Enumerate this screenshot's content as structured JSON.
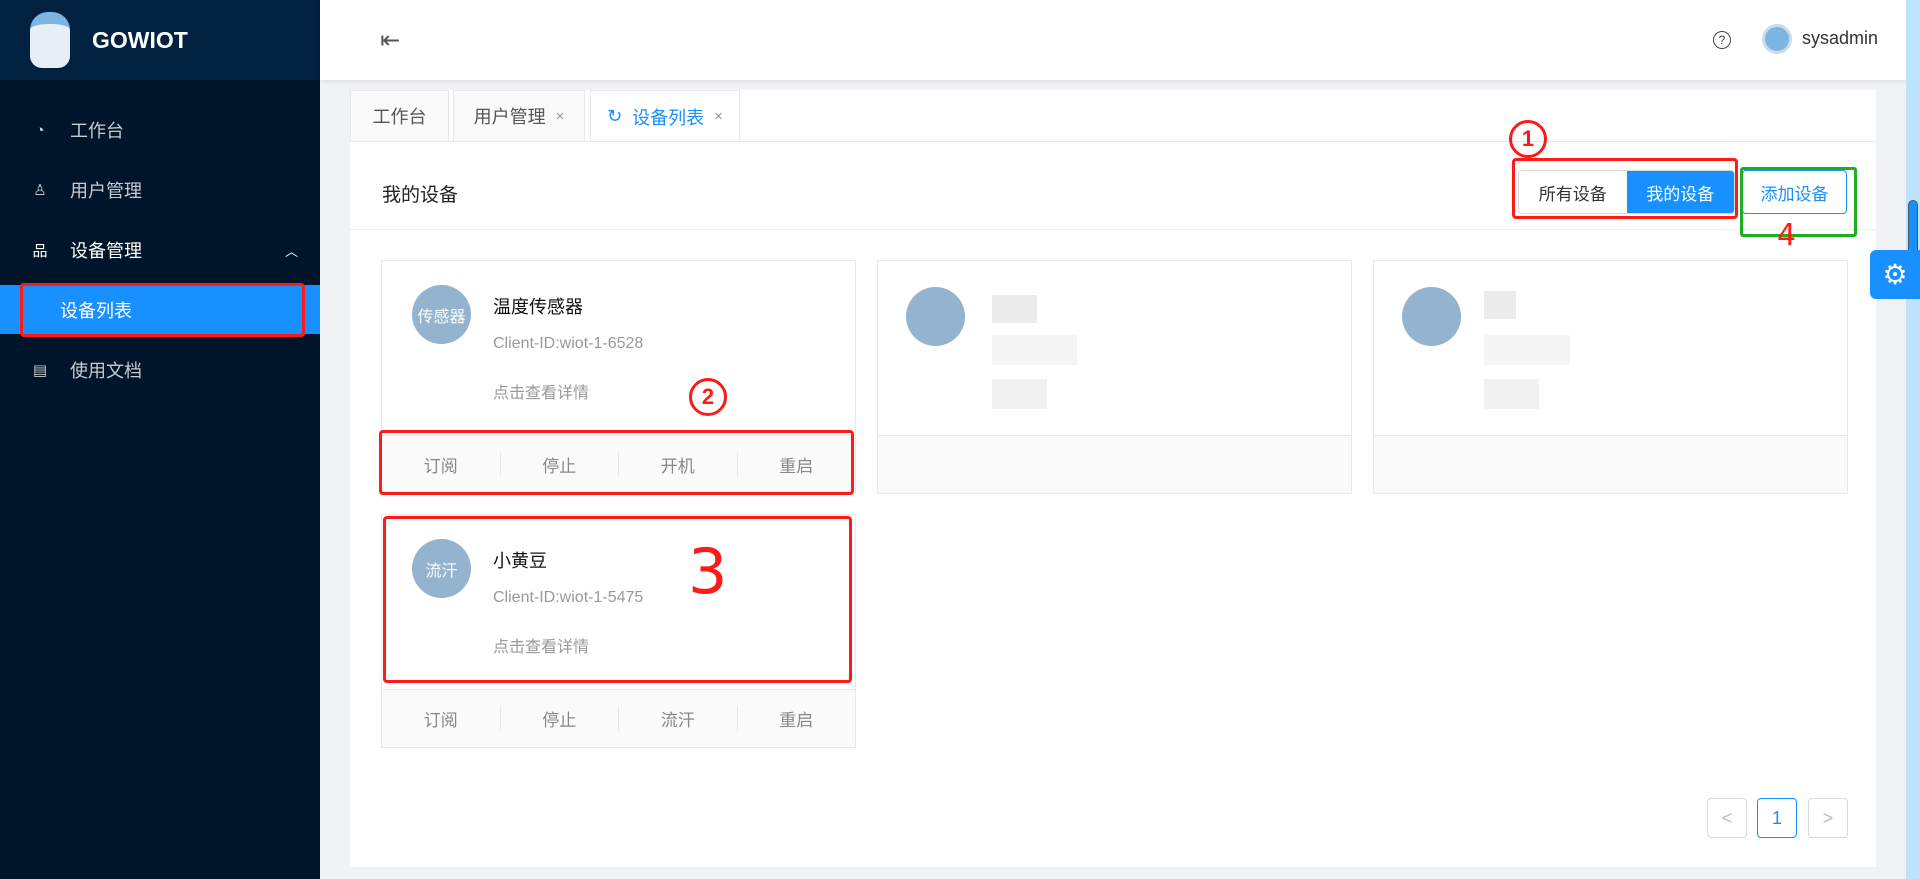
{
  "app": {
    "name": "GOWIOT"
  },
  "sidebar": {
    "items": [
      {
        "label": "工作台",
        "icon": "dashboard-icon"
      },
      {
        "label": "用户管理",
        "icon": "user-icon"
      },
      {
        "label": "设备管理",
        "icon": "cluster-icon",
        "expanded": true,
        "children": [
          {
            "label": "设备列表",
            "active": true
          }
        ]
      },
      {
        "label": "使用文档",
        "icon": "file-word-icon"
      }
    ]
  },
  "header": {
    "user": "sysadmin",
    "help": "?"
  },
  "tabs": [
    {
      "label": "工作台"
    },
    {
      "label": "用户管理",
      "close": "×"
    },
    {
      "label": "设备列表",
      "close": "×",
      "active": true
    }
  ],
  "main": {
    "title": "我的设备",
    "filter": {
      "options": [
        "所有设备",
        "我的设备"
      ],
      "selected": "我的设备"
    },
    "add_button": "添加设备",
    "devices": [
      {
        "avatar": "传感器",
        "name": "温度传感器",
        "client_id": "Client-ID:wiot-1-6528",
        "detail": "点击查看详情",
        "actions": [
          "订阅",
          "停止",
          "开机",
          "重启"
        ]
      },
      {
        "avatar": "流汗",
        "name": "小黄豆",
        "client_id": "Client-ID:wiot-1-5475",
        "detail": "点击查看详情",
        "actions": [
          "订阅",
          "停止",
          "流汗",
          "重启"
        ]
      }
    ],
    "pagination": {
      "prev": "<",
      "current": "1",
      "next": ">"
    }
  },
  "annotations": [
    "1",
    "2",
    "3",
    "4"
  ]
}
